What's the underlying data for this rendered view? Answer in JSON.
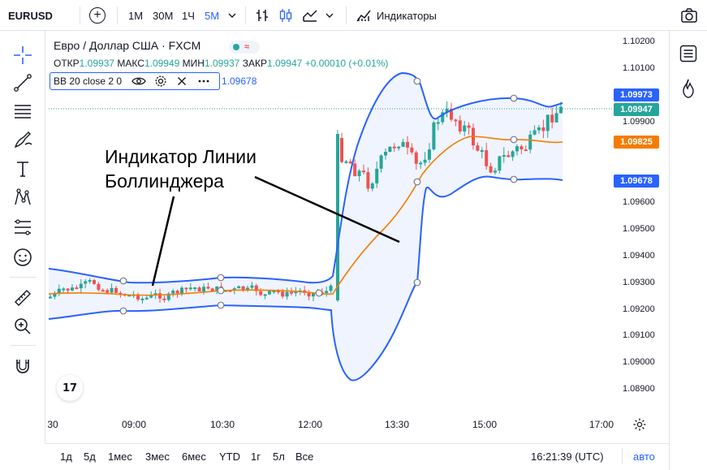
{
  "topbar": {
    "symbol": "EURUSD",
    "intervals": [
      "1M",
      "30M",
      "1Ч",
      "5M"
    ],
    "active_interval": "5M",
    "indicators_label": "Индикаторы"
  },
  "legend": {
    "title": "Евро / Доллар США · FXCM",
    "open_label": "ОТКР",
    "open": "1.09937",
    "high_label": "МАКС",
    "high": "1.09949",
    "low_label": "МИН",
    "low": "1.09937",
    "close_label": "ЗАКР",
    "close": "1.09947",
    "change": "+0.00010 (+0.01%)",
    "bb_label": "BB 20 close 2 0",
    "bb_value": "1.09678"
  },
  "price_axis": {
    "labels": [
      "1.10200",
      "1.10100",
      "1.09900",
      "1.09600",
      "1.09500",
      "1.09400",
      "1.09300",
      "1.09200",
      "1.09100",
      "1.09000",
      "1.08900"
    ],
    "badges": [
      {
        "value": "1.09973",
        "color": "#2962ff"
      },
      {
        "value": "1.09947",
        "color": "#26a69a"
      },
      {
        "value": "1.09825",
        "color": "#f57c00"
      },
      {
        "value": "1.09678",
        "color": "#2962ff"
      }
    ]
  },
  "time_axis": {
    "labels": [
      "30",
      "09:00",
      "10:30",
      "12:00",
      "13:30",
      "15:00",
      "17:00"
    ]
  },
  "annotation": {
    "text": "Индикатор Линии\nБоллинджера"
  },
  "bottombar": {
    "ranges": [
      "1д",
      "5д",
      "1мес",
      "3мес",
      "6мес",
      "YTD",
      "1г",
      "5л",
      "Все"
    ],
    "clock": "16:21:39 (UTC)",
    "auto_label": "авто"
  },
  "colors": {
    "up": "#26a69a",
    "down": "#ef5350",
    "bb_band": "#2962ff",
    "bb_basis": "#f57c00",
    "accent": "#2962ff"
  },
  "icons": {
    "left_tools": [
      "crosshair-icon",
      "trendline-icon",
      "fib-icon",
      "brush-icon",
      "text-icon",
      "pattern-icon",
      "prediction-icon",
      "emoji-icon",
      "ruler-icon",
      "zoom-icon",
      "magnet-icon"
    ]
  }
}
